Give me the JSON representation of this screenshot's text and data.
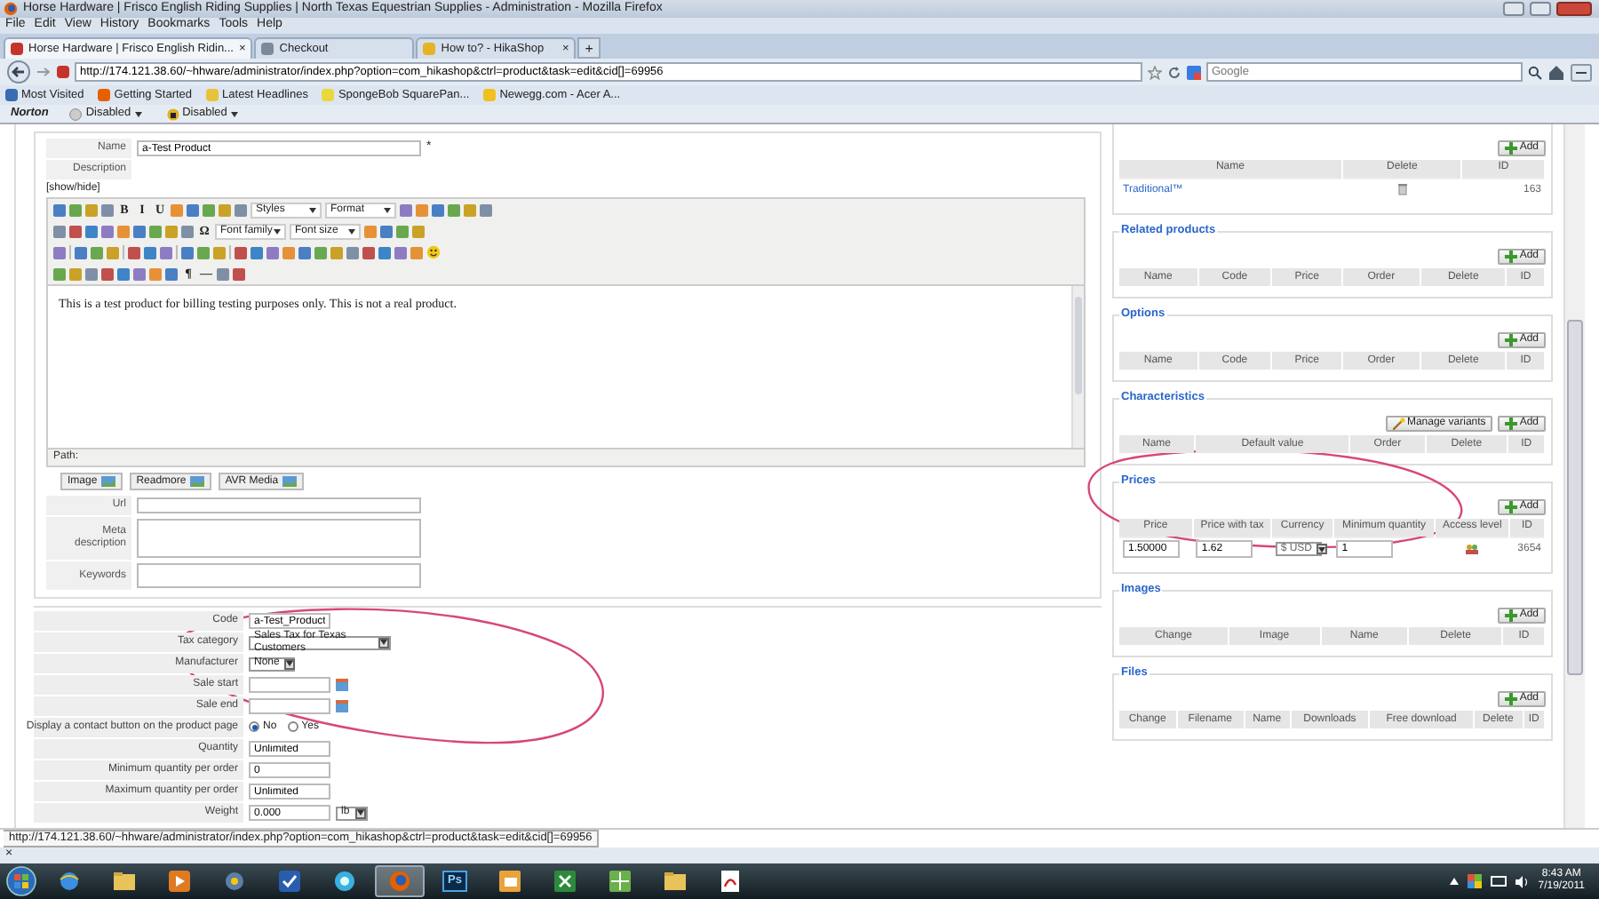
{
  "window": {
    "title": "Horse Hardware | Frisco English Riding Supplies | North Texas Equestrian Supplies - Administration - Mozilla Firefox"
  },
  "menu": [
    "File",
    "Edit",
    "View",
    "History",
    "Bookmarks",
    "Tools",
    "Help"
  ],
  "tabs": [
    {
      "label": "Horse Hardware | Frisco English Ridin...",
      "selected": true,
      "close": "×"
    },
    {
      "label": "Checkout",
      "selected": false
    },
    {
      "label": "How to? - HikaShop",
      "selected": false,
      "close": "×"
    }
  ],
  "new_tab": "+",
  "address": {
    "value": "http://174.121.38.60/~hhware/administrator/index.php?option=com_hikashop&ctrl=product&task=edit&cid[]=69956"
  },
  "search": {
    "placeholder": "Google"
  },
  "bookmarks": [
    "Most Visited",
    "Getting Started",
    "Latest Headlines",
    "SpongeBob SquarePan...",
    "Newegg.com - Acer A..."
  ],
  "norton": {
    "label": "Norton",
    "items": [
      "Disabled",
      "Disabled"
    ]
  },
  "product_form": {
    "name": {
      "label": "Name",
      "value": "a-Test Product",
      "mark": "*"
    },
    "description_label": "Description",
    "show_hide": "[show/hide]",
    "editor": {
      "toolbar": [
        [
          {
            "kind": "icon"
          },
          {
            "kind": "icon"
          },
          {
            "kind": "icon"
          },
          {
            "kind": "icon"
          },
          {
            "kind": "glyph",
            "text": "B"
          },
          {
            "kind": "glyph",
            "text": "I"
          },
          {
            "kind": "glyph",
            "text": "U"
          },
          {
            "kind": "icon"
          },
          {
            "kind": "icon"
          },
          {
            "kind": "icon"
          },
          {
            "kind": "icon"
          },
          {
            "kind": "icon"
          },
          {
            "kind": "select",
            "text": "Styles"
          },
          {
            "kind": "select",
            "text": "Format"
          },
          {
            "kind": "icon"
          },
          {
            "kind": "icon"
          },
          {
            "kind": "icon"
          },
          {
            "kind": "icon"
          },
          {
            "kind": "icon"
          },
          {
            "kind": "icon"
          }
        ],
        [
          {
            "kind": "icon"
          },
          {
            "kind": "icon"
          },
          {
            "kind": "icon"
          },
          {
            "kind": "icon"
          },
          {
            "kind": "icon"
          },
          {
            "kind": "icon"
          },
          {
            "kind": "icon"
          },
          {
            "kind": "icon"
          },
          {
            "kind": "icon"
          },
          {
            "kind": "glyph",
            "text": "Ω"
          },
          {
            "kind": "select",
            "text": "Font family"
          },
          {
            "kind": "select",
            "text": "Font size"
          },
          {
            "kind": "icon"
          },
          {
            "kind": "icon"
          },
          {
            "kind": "icon"
          },
          {
            "kind": "icon"
          }
        ],
        [
          {
            "kind": "icon"
          },
          {
            "kind": "sep"
          },
          {
            "kind": "icon"
          },
          {
            "kind": "icon"
          },
          {
            "kind": "icon"
          },
          {
            "kind": "sep"
          },
          {
            "kind": "icon"
          },
          {
            "kind": "icon"
          },
          {
            "kind": "icon"
          },
          {
            "kind": "sep"
          },
          {
            "kind": "icon"
          },
          {
            "kind": "icon"
          },
          {
            "kind": "icon"
          },
          {
            "kind": "sep"
          },
          {
            "kind": "icon"
          },
          {
            "kind": "icon"
          },
          {
            "kind": "icon"
          },
          {
            "kind": "icon"
          },
          {
            "kind": "icon"
          },
          {
            "kind": "icon"
          },
          {
            "kind": "icon"
          },
          {
            "kind": "icon"
          },
          {
            "kind": "icon"
          },
          {
            "kind": "icon"
          },
          {
            "kind": "icon"
          },
          {
            "kind": "icon"
          },
          {
            "kind": "smiley"
          }
        ],
        [
          {
            "kind": "icon"
          },
          {
            "kind": "icon"
          },
          {
            "kind": "icon"
          },
          {
            "kind": "icon"
          },
          {
            "kind": "icon"
          },
          {
            "kind": "icon"
          },
          {
            "kind": "icon"
          },
          {
            "kind": "icon"
          },
          {
            "kind": "glyph",
            "text": "¶"
          },
          {
            "kind": "glyph",
            "text": "—"
          },
          {
            "kind": "icon"
          },
          {
            "kind": "icon"
          }
        ]
      ],
      "content": "This is a test product for billing testing purposes only. This is not a real product.",
      "path": "Path:"
    },
    "editor_buttons": [
      "Image",
      "Readmore",
      "AVR Media"
    ],
    "meta_fields": [
      {
        "label": "Url",
        "kind": "input"
      },
      {
        "label": "Meta description",
        "kind": "textarea"
      },
      {
        "label": "Keywords",
        "kind": "textarea"
      }
    ]
  },
  "details_form": [
    {
      "label": "Code",
      "kind": "text",
      "value": "a-Test_Product"
    },
    {
      "label": "Tax category",
      "kind": "select",
      "value": "Sales Tax for Texas Customers"
    },
    {
      "label": "Manufacturer",
      "kind": "select",
      "value": "None"
    },
    {
      "label": "Sale start",
      "kind": "date"
    },
    {
      "label": "Sale end",
      "kind": "date"
    },
    {
      "label": "Display a contact button on the product page",
      "kind": "radio",
      "options": [
        {
          "label": "No",
          "selected": true
        },
        {
          "label": "Yes",
          "selected": false
        }
      ]
    },
    {
      "label": "Quantity",
      "kind": "text",
      "value": "Unlimited"
    },
    {
      "label": "Minimum quantity per order",
      "kind": "text",
      "value": "0"
    },
    {
      "label": "Maximum quantity per order",
      "kind": "text",
      "value": "Unlimited"
    },
    {
      "label": "Weight",
      "kind": "weight",
      "value": "0.000",
      "unit": "lb"
    }
  ],
  "sections": [
    {
      "buttons": [
        "Add"
      ],
      "columns": [
        "Name",
        "Delete",
        "ID"
      ],
      "rows": [
        [
          {
            "kind": "link",
            "text": "Traditional™"
          },
          {
            "kind": "trash"
          },
          {
            "kind": "text",
            "text": "163"
          }
        ]
      ]
    },
    {
      "title": "Related products",
      "buttons": [
        "Add"
      ],
      "columns": [
        "Name",
        "Code",
        "Price",
        "Order",
        "Delete",
        "ID"
      ]
    },
    {
      "title": "Options",
      "buttons": [
        "Add"
      ],
      "columns": [
        "Name",
        "Code",
        "Price",
        "Order",
        "Delete",
        "ID"
      ]
    },
    {
      "title": "Characteristics",
      "buttons": [
        "Manage variants",
        "Add"
      ],
      "columns": [
        "Name",
        "Default value",
        "Order",
        "Delete",
        "ID"
      ]
    },
    {
      "title": "Prices",
      "buttons": [
        "Add"
      ],
      "columns": [
        "Price",
        "Price with tax",
        "Currency",
        "Minimum quantity",
        "Access level",
        "ID"
      ],
      "rows": [
        [
          {
            "kind": "input",
            "text": "1.50000"
          },
          {
            "kind": "input",
            "text": "1.62"
          },
          {
            "kind": "select",
            "text": "$ USD"
          },
          {
            "kind": "input",
            "text": "1"
          },
          {
            "kind": "access"
          },
          {
            "kind": "text",
            "text": "3654"
          }
        ]
      ]
    },
    {
      "title": "Images",
      "buttons": [
        "Add"
      ],
      "columns": [
        "Change",
        "Image",
        "Name",
        "Delete",
        "ID"
      ]
    },
    {
      "title": "Files",
      "buttons": [
        "Add"
      ],
      "columns": [
        "Change",
        "Filename",
        "Name",
        "Downloads",
        "Free download",
        "Delete",
        "ID"
      ]
    }
  ],
  "status_bar": {
    "text": "http://174.121.38.60/~hhware/administrator/index.php?option=com_hikashop&ctrl=product&task=edit&cid[]=69956",
    "close": "×"
  },
  "taskbar": {
    "apps": [
      {
        "kind": "ie",
        "selected": false
      },
      {
        "kind": "folder",
        "selected": false
      },
      {
        "kind": "media",
        "selected": false
      },
      {
        "kind": "globe",
        "selected": false
      },
      {
        "kind": "check",
        "selected": false
      },
      {
        "kind": "orb",
        "selected": false
      },
      {
        "kind": "firefox",
        "selected": true
      },
      {
        "kind": "ps",
        "label": "Ps",
        "selected": false
      },
      {
        "kind": "outlook",
        "selected": false
      },
      {
        "kind": "excel",
        "selected": false
      },
      {
        "kind": "green",
        "selected": false
      },
      {
        "kind": "folder",
        "selected": false
      },
      {
        "kind": "pdf",
        "selected": false
      }
    ],
    "time": "8:43 AM",
    "date": "7/19/2011"
  }
}
